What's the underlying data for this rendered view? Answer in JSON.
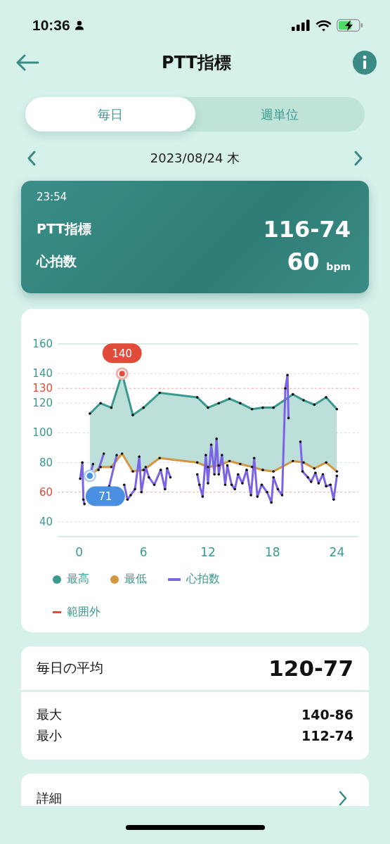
{
  "status_bar": {
    "time": "10:36"
  },
  "header": {
    "title": "PTT指標"
  },
  "tabs": [
    {
      "label": "毎日",
      "selected": true
    },
    {
      "label": "週単位",
      "selected": false
    }
  ],
  "date_nav": {
    "date": "2023/08/24 木"
  },
  "summary": {
    "time": "23:54",
    "rows": [
      {
        "label": "PTT指標",
        "value": "116-74",
        "unit": ""
      },
      {
        "label": "心拍数",
        "value": "60",
        "unit": "bpm"
      }
    ]
  },
  "chart": {
    "chart_data": {
      "type": "line",
      "xlim": [
        -2,
        26
      ],
      "ylim": [
        30,
        160
      ],
      "grid": true,
      "xticks": [
        0,
        6,
        12,
        18,
        24
      ],
      "yticks": [
        40,
        60,
        80,
        100,
        120,
        130,
        140,
        160
      ],
      "x": [
        1,
        2,
        3,
        4,
        5,
        6,
        7.5,
        11,
        12,
        13,
        14,
        15,
        16.1,
        17.1,
        18.1,
        19.9,
        20.9,
        21.9,
        23,
        24
      ],
      "series": [
        {
          "name": "最高",
          "color": "#3a9a8e",
          "values": [
            113,
            120,
            117,
            140,
            112,
            117,
            127,
            124,
            117,
            120,
            123,
            120,
            116,
            117,
            117,
            126,
            122,
            119,
            124,
            116
          ]
        },
        {
          "name": "最低",
          "color": "#d4963f",
          "values": [
            71,
            77,
            77,
            86,
            74,
            75,
            83,
            80,
            77,
            78,
            81,
            79,
            77,
            75,
            74,
            81,
            80,
            76,
            80,
            74
          ]
        },
        {
          "name": "心拍数",
          "color": "#7b63e6",
          "x": [
            0.1,
            0.3,
            0.4,
            0.5,
            0.8,
            1,
            1.3,
            1.5,
            1.8,
            2.3,
            2.5,
            2.8,
            3.5,
            3.7,
            4.2,
            4.5,
            4.8,
            5.2,
            5.6,
            5.8,
            6.2,
            6.5,
            7,
            7.6,
            8,
            8.2,
            8.5,
            9.5,
            11,
            11.2,
            11.5,
            11.8,
            12,
            12.3,
            12.6,
            12.8,
            13,
            13.3,
            13.6,
            13.8,
            14.2,
            14.5,
            14.8,
            15.2,
            15.6,
            16,
            16.3,
            16.6,
            17,
            17.5,
            17.9,
            18.1,
            18.5,
            18.9,
            19.2,
            19.4,
            19.5,
            20,
            20.6,
            20.8,
            21.3,
            21.6,
            22,
            22.3,
            22.7,
            23,
            23.4,
            23.7,
            24
          ],
          "values": [
            69,
            80,
            55,
            52,
            null,
            71,
            79,
            null,
            75,
            86,
            null,
            64,
            85,
            null,
            65,
            55,
            58,
            62,
            84,
            60,
            77,
            70,
            65,
            75,
            62,
            76,
            70,
            null,
            72,
            65,
            57,
            85,
            66,
            92,
            72,
            96,
            72,
            85,
            65,
            78,
            65,
            62,
            72,
            66,
            75,
            58,
            83,
            57,
            65,
            60,
            53,
            70,
            62,
            58,
            130,
            139,
            110,
            null,
            94,
            74,
            70,
            67,
            73,
            66,
            72,
            64,
            65,
            55,
            71
          ]
        }
      ]
    },
    "ytick_limits": [
      false,
      true,
      false,
      false,
      false,
      true,
      false,
      false
    ],
    "callouts": [
      {
        "kind": "peak",
        "label": "140"
      },
      {
        "kind": "cursor",
        "label": "71"
      }
    ],
    "legend": [
      {
        "kind": "dot"
      },
      {
        "kind": "dot"
      },
      {
        "kind": "line"
      },
      {
        "kind": "dash",
        "label": "範囲外",
        "color": "#e04b3a"
      }
    ]
  },
  "stats": {
    "average": {
      "label": "毎日の平均",
      "value": "120-77"
    },
    "rows": [
      {
        "label": "最大",
        "value": "140-86"
      },
      {
        "label": "最小",
        "value": "112-74"
      }
    ]
  },
  "details": {
    "label": "詳細"
  }
}
